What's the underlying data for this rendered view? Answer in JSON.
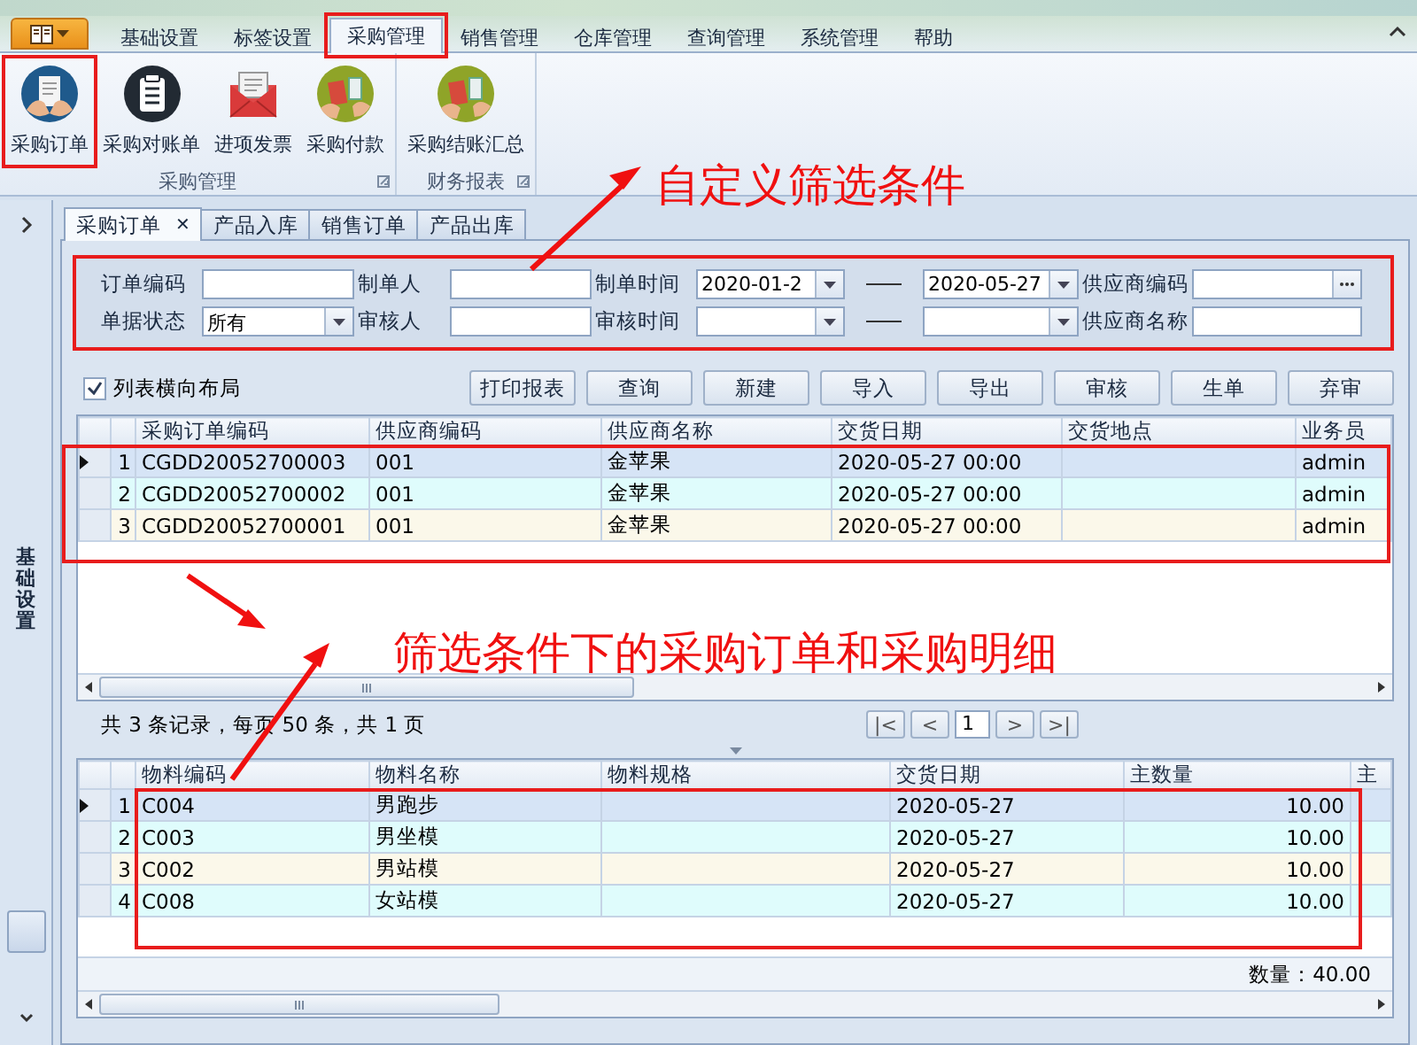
{
  "ribbon": {
    "tabs": [
      {
        "label": "基础设置",
        "selected": false
      },
      {
        "label": "标签设置",
        "selected": false
      },
      {
        "label": "采购管理",
        "selected": true
      },
      {
        "label": "销售管理",
        "selected": false
      },
      {
        "label": "仓库管理",
        "selected": false
      },
      {
        "label": "查询管理",
        "selected": false
      },
      {
        "label": "系统管理",
        "selected": false
      },
      {
        "label": "帮助",
        "selected": false
      }
    ],
    "groups": [
      {
        "title": "采购管理",
        "buttons": [
          {
            "label": "采购订单"
          },
          {
            "label": "采购对账单"
          },
          {
            "label": "进项发票"
          },
          {
            "label": "采购付款"
          }
        ]
      },
      {
        "title": "财务报表",
        "buttons": [
          {
            "label": "采购结账汇总"
          }
        ]
      }
    ]
  },
  "side_panel": {
    "title": "基础设置"
  },
  "doc_tabs": [
    {
      "label": "采购订单",
      "selected": true,
      "close": "✕"
    },
    {
      "label": "产品入库",
      "selected": false
    },
    {
      "label": "销售订单",
      "selected": false
    },
    {
      "label": "产品出库",
      "selected": false
    }
  ],
  "filter": {
    "rows": [
      [
        {
          "kind": "label",
          "text": "订单编码"
        },
        {
          "kind": "input"
        },
        {
          "kind": "label",
          "text": "制单人"
        },
        {
          "kind": "input"
        },
        {
          "kind": "label",
          "text": "制单时间"
        },
        {
          "kind": "date",
          "value": "2020-01-2"
        },
        {
          "kind": "dash"
        },
        {
          "kind": "date",
          "value": "2020-05-27"
        },
        {
          "kind": "label",
          "text": "供应商编码"
        },
        {
          "kind": "lookup"
        }
      ],
      [
        {
          "kind": "label",
          "text": "单据状态"
        },
        {
          "kind": "combo",
          "value": "所有"
        },
        {
          "kind": "label",
          "text": "审核人"
        },
        {
          "kind": "input"
        },
        {
          "kind": "label",
          "text": "审核时间"
        },
        {
          "kind": "date"
        },
        {
          "kind": "dash"
        },
        {
          "kind": "date"
        },
        {
          "kind": "label",
          "text": "供应商名称"
        },
        {
          "kind": "input"
        }
      ]
    ]
  },
  "layout_checkbox": {
    "label": "列表横向布局",
    "checked": true
  },
  "toolbar": [
    "打印报表",
    "查询",
    "新建",
    "导入",
    "导出",
    "审核",
    "生单",
    "弃审"
  ],
  "orders_table": {
    "columns": [
      "采购订单编码",
      "供应商编码",
      "供应商名称",
      "交货日期",
      "交货地点",
      "业务员"
    ],
    "rows": [
      {
        "index": "1",
        "selected": true,
        "cells": [
          "CGDD20052700003",
          "001",
          "金苹果",
          "2020-05-27 00:00",
          "",
          "admin"
        ]
      },
      {
        "index": "2",
        "selected": false,
        "cells": [
          "CGDD20052700002",
          "001",
          "金苹果",
          "2020-05-27 00:00",
          "",
          "admin"
        ]
      },
      {
        "index": "3",
        "selected": false,
        "cells": [
          "CGDD20052700001",
          "001",
          "金苹果",
          "2020-05-27 00:00",
          "",
          "admin"
        ]
      }
    ]
  },
  "pager": {
    "summary": "共 3 条记录，每页 50 条，共 1 页",
    "first": "|<",
    "prev": "<",
    "page": "1",
    "next": ">",
    "last": ">|"
  },
  "details_table": {
    "columns": [
      "物料编码",
      "物料名称",
      "物料规格",
      "交货日期",
      "主数量",
      "主"
    ],
    "rows": [
      {
        "index": "1",
        "selected": true,
        "cells": [
          "C004",
          "男跑步",
          "",
          "2020-05-27",
          "10.00",
          ""
        ]
      },
      {
        "index": "2",
        "selected": false,
        "cells": [
          "C003",
          "男坐模",
          "",
          "2020-05-27",
          "10.00",
          ""
        ]
      },
      {
        "index": "3",
        "selected": false,
        "cells": [
          "C002",
          "男站模",
          "",
          "2020-05-27",
          "10.00",
          ""
        ]
      },
      {
        "index": "4",
        "selected": false,
        "cells": [
          "C008",
          "女站模",
          "",
          "2020-05-27",
          "10.00",
          ""
        ]
      }
    ],
    "total": "数量：40.00"
  },
  "annotations": [
    "自定义筛选条件",
    "筛选条件下的采购订单和采购明细"
  ]
}
